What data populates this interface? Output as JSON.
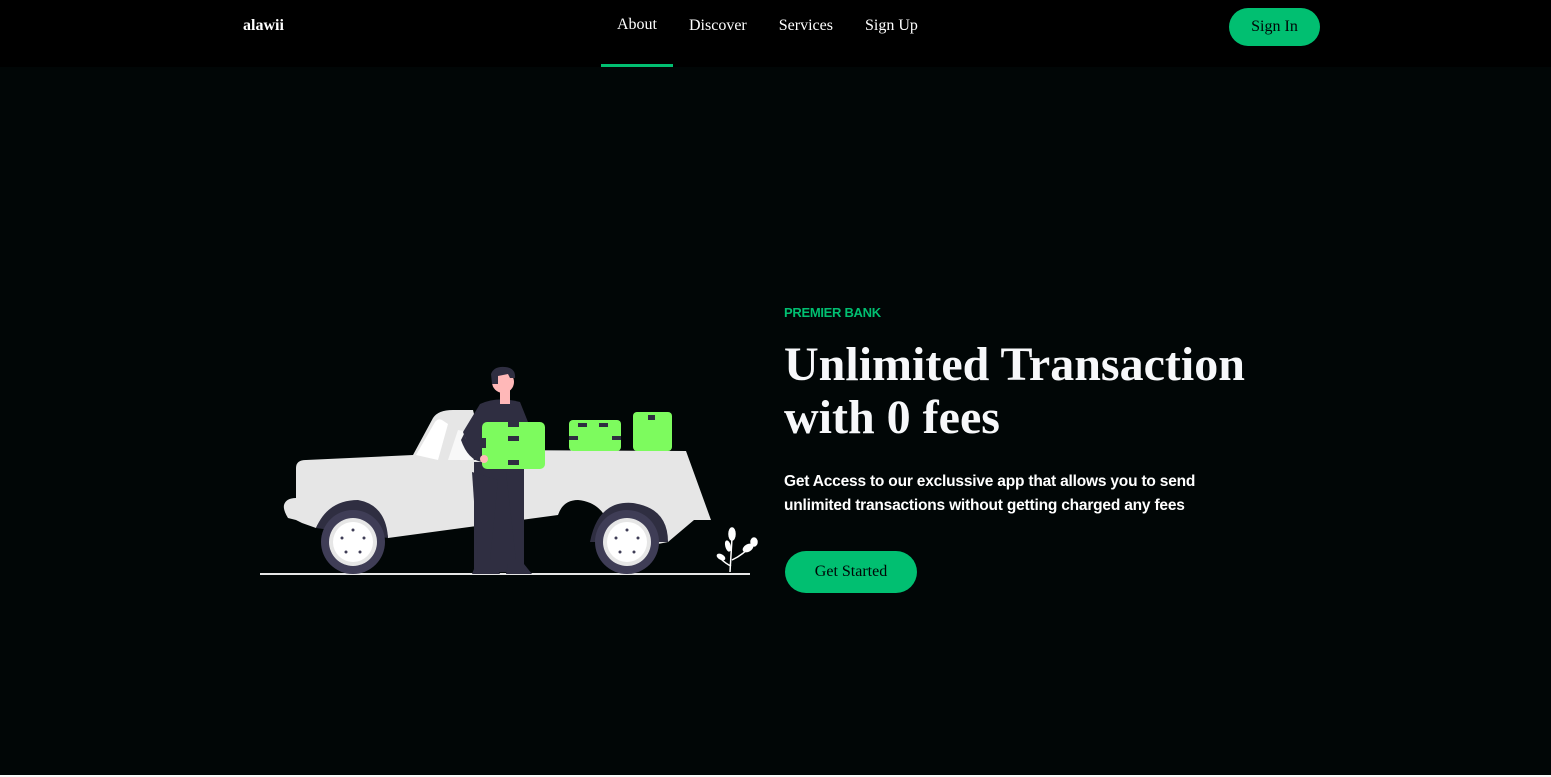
{
  "navbar": {
    "logo": "alawii",
    "links": [
      {
        "label": "About",
        "active": true
      },
      {
        "label": "Discover"
      },
      {
        "label": "Services"
      },
      {
        "label": "Sign Up"
      }
    ],
    "signin_label": "Sign In"
  },
  "hero": {
    "top_line": "PREMIER BANK",
    "heading": "Unlimited Transaction with 0 fees",
    "description": "Get Access to our exclussive app that allows you to send unlimited transactions without getting charged any fees",
    "cta_label": "Get Started",
    "illustration_icon": "person-unloading-car-illustration"
  },
  "colors": {
    "accent": "#01bf71",
    "background": "#010606",
    "navbar": "#000000",
    "box_green": "#7dfb5e"
  }
}
